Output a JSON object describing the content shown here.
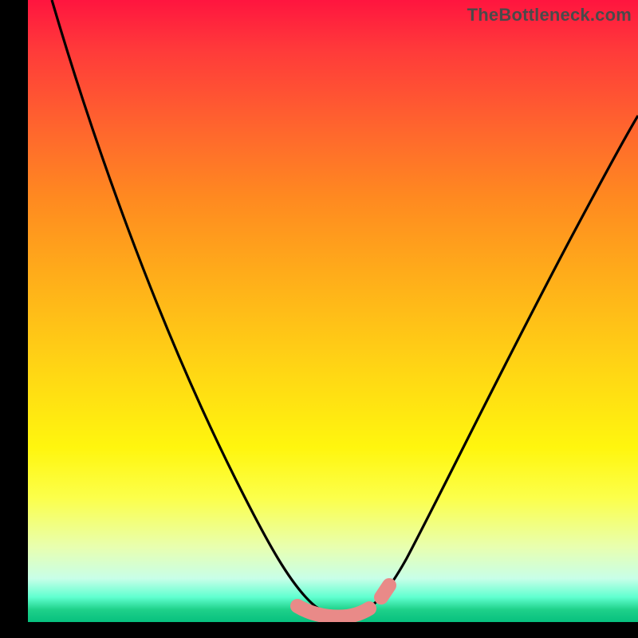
{
  "watermark": "TheBottleneck.com",
  "colors": {
    "curve": "#000000",
    "marker": "#e98a88",
    "frame": "#000000"
  },
  "chart_data": {
    "type": "line",
    "title": "",
    "xlabel": "",
    "ylabel": "",
    "xlim": [
      0,
      100
    ],
    "ylim": [
      0,
      100
    ],
    "grid": false,
    "legend": false,
    "background_gradient_top_to_bottom": [
      "#ff153f",
      "#fff60e",
      "#07c07e"
    ],
    "series": [
      {
        "name": "bottleneck-curve",
        "x": [
          1,
          6,
          12,
          18,
          24,
          30,
          36,
          41,
          45,
          48,
          50,
          52,
          54,
          58,
          62,
          68,
          76,
          84,
          92,
          99
        ],
        "values": [
          100,
          86,
          72,
          58,
          45,
          33,
          22,
          12,
          6,
          2,
          1,
          1,
          2,
          5,
          10,
          18,
          30,
          44,
          58,
          72
        ]
      }
    ],
    "markers": [
      {
        "name": "flat-bottom-segment",
        "x_start": 44,
        "x_end": 54,
        "y": 1
      },
      {
        "name": "right-uptick-dot",
        "x_start": 56,
        "x_end": 57,
        "y": 4
      }
    ]
  }
}
